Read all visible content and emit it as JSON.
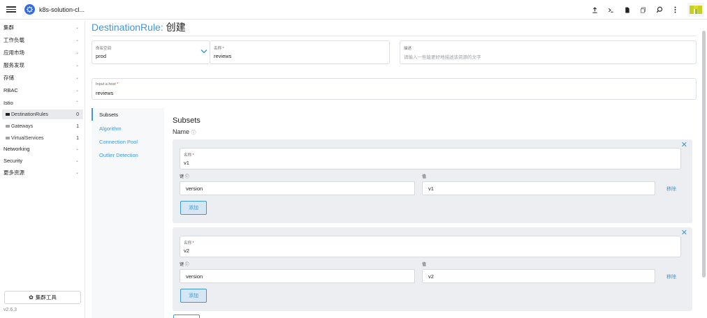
{
  "header": {
    "cluster_name": "k8s-solution-cl...",
    "icons": [
      "upload-icon",
      "shell-icon",
      "file-icon",
      "copy-icon",
      "search-icon",
      "more-icon",
      "rancher-logo"
    ]
  },
  "sidebar": {
    "items": [
      {
        "label": "集群",
        "chevron": "down"
      },
      {
        "label": "工作负载",
        "chevron": "down"
      },
      {
        "label": "应用市场",
        "chevron": "down"
      },
      {
        "label": "服务发现",
        "chevron": "down"
      },
      {
        "label": "存储",
        "chevron": "down"
      },
      {
        "label": "RBAC",
        "chevron": "down"
      },
      {
        "label": "Istio",
        "chevron": "up"
      }
    ],
    "istio_children": [
      {
        "label": "DestinationRules",
        "count": "0",
        "active": true
      },
      {
        "label": "Gateways",
        "count": "1",
        "active": false
      },
      {
        "label": "VirtualServices",
        "count": "1",
        "active": false
      }
    ],
    "bottom_items": [
      {
        "label": "Networking",
        "chevron": "down"
      },
      {
        "label": "Security",
        "chevron": "down"
      },
      {
        "label": "更多资源",
        "chevron": "down"
      }
    ],
    "cluster_tools_label": "集群工具",
    "version": "v2.6.3"
  },
  "page": {
    "title_resource": "DestinationRule:",
    "title_action": "创建"
  },
  "form": {
    "namespace": {
      "label": "命名空间",
      "value": "prod"
    },
    "name": {
      "label": "名称",
      "required": "*",
      "value": "reviews"
    },
    "description": {
      "label": "描述",
      "placeholder": "请输入一些能更好地描述该资源的文字"
    },
    "host": {
      "label": "Input a host",
      "required": "*",
      "value": "reviews"
    }
  },
  "tabs": [
    {
      "label": "Subsets",
      "active": true
    },
    {
      "label": "Algorithm",
      "active": false
    },
    {
      "label": "Connection Pool",
      "active": false
    },
    {
      "label": "Outlier Detection",
      "active": false
    }
  ],
  "subsets_section": {
    "title": "Subsets",
    "name_label": "Name",
    "subsets": [
      {
        "name_label": "名称",
        "name_value": "v1",
        "key_header": "键",
        "value_header": "值",
        "key": "version",
        "value": "v1",
        "remove_label": "移除",
        "add_label": "添加"
      },
      {
        "name_label": "名称",
        "name_value": "v2",
        "key_header": "键",
        "value_header": "值",
        "key": "version",
        "value": "v2",
        "remove_label": "移除",
        "add_label": "添加"
      }
    ]
  },
  "colors": {
    "accent": "#3d98d3",
    "required": "#dd2233",
    "panel_bg": "#f7f8fa",
    "subset_bg": "#eceef1"
  }
}
